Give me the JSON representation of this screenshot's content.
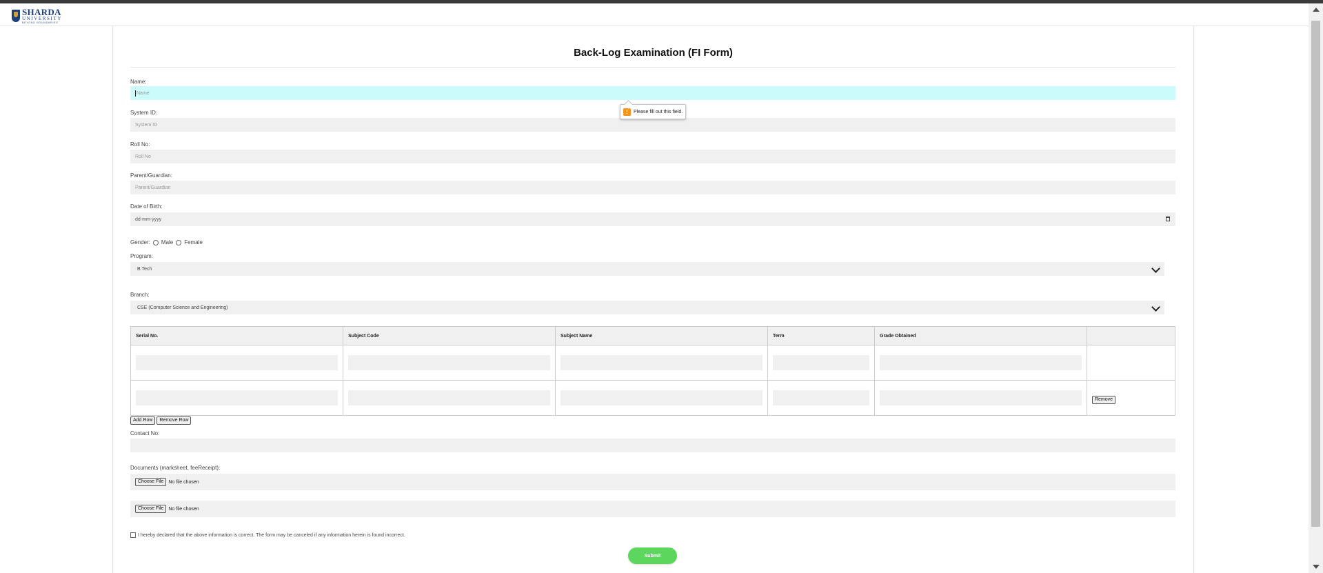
{
  "brand": {
    "name": "SHARDA",
    "sub": "UNIVERSITY",
    "tagline": "BEYOND BOUNDARIES"
  },
  "form": {
    "title": "Back-Log Examination (FI Form)",
    "name": {
      "label": "Name:",
      "placeholder": "Name"
    },
    "validation_tooltip": "Please fill out this field.",
    "system_id": {
      "label": "System ID:",
      "placeholder": "System ID"
    },
    "roll_no": {
      "label": "Roll No:",
      "placeholder": "Roll No"
    },
    "parent": {
      "label": "Parent/Guardian:",
      "placeholder": "Parent/Guardian"
    },
    "dob": {
      "label": "Date of Birth:",
      "placeholder": "dd-mm-yyyy"
    },
    "gender": {
      "label": "Gender:",
      "male": "Male",
      "female": "Female"
    },
    "program": {
      "label": "Program:",
      "selected": "B.Tech"
    },
    "branch": {
      "label": "Branch:",
      "selected": "CSE (Computer Science and Engineering)"
    },
    "table": {
      "headers": [
        "Serial No.",
        "Subject Code",
        "Subject Name",
        "Term",
        "Grade Obtained",
        ""
      ],
      "remove_label": "Remove"
    },
    "add_row": "Add Row",
    "remove_row": "Remove Row",
    "contact": {
      "label": "Contact No:"
    },
    "documents": {
      "label": "Documents (marksheet, feeReceipt):",
      "choose": "Choose File",
      "none": "No file chosen"
    },
    "declaration": "I hereby declared that the above information is correct. The form may be canceled if any information herein is found incorrect.",
    "submit": "Submit"
  },
  "colors": {
    "accent_focus": "#ccfbfc",
    "submit": "#5cd65c",
    "warning": "#f7941d",
    "brand": "#1f3f7a"
  },
  "icons": [
    "warning-icon",
    "calendar-icon",
    "chevron-down-icon",
    "scroll-up-arrow-icon",
    "scroll-down-arrow-icon"
  ]
}
